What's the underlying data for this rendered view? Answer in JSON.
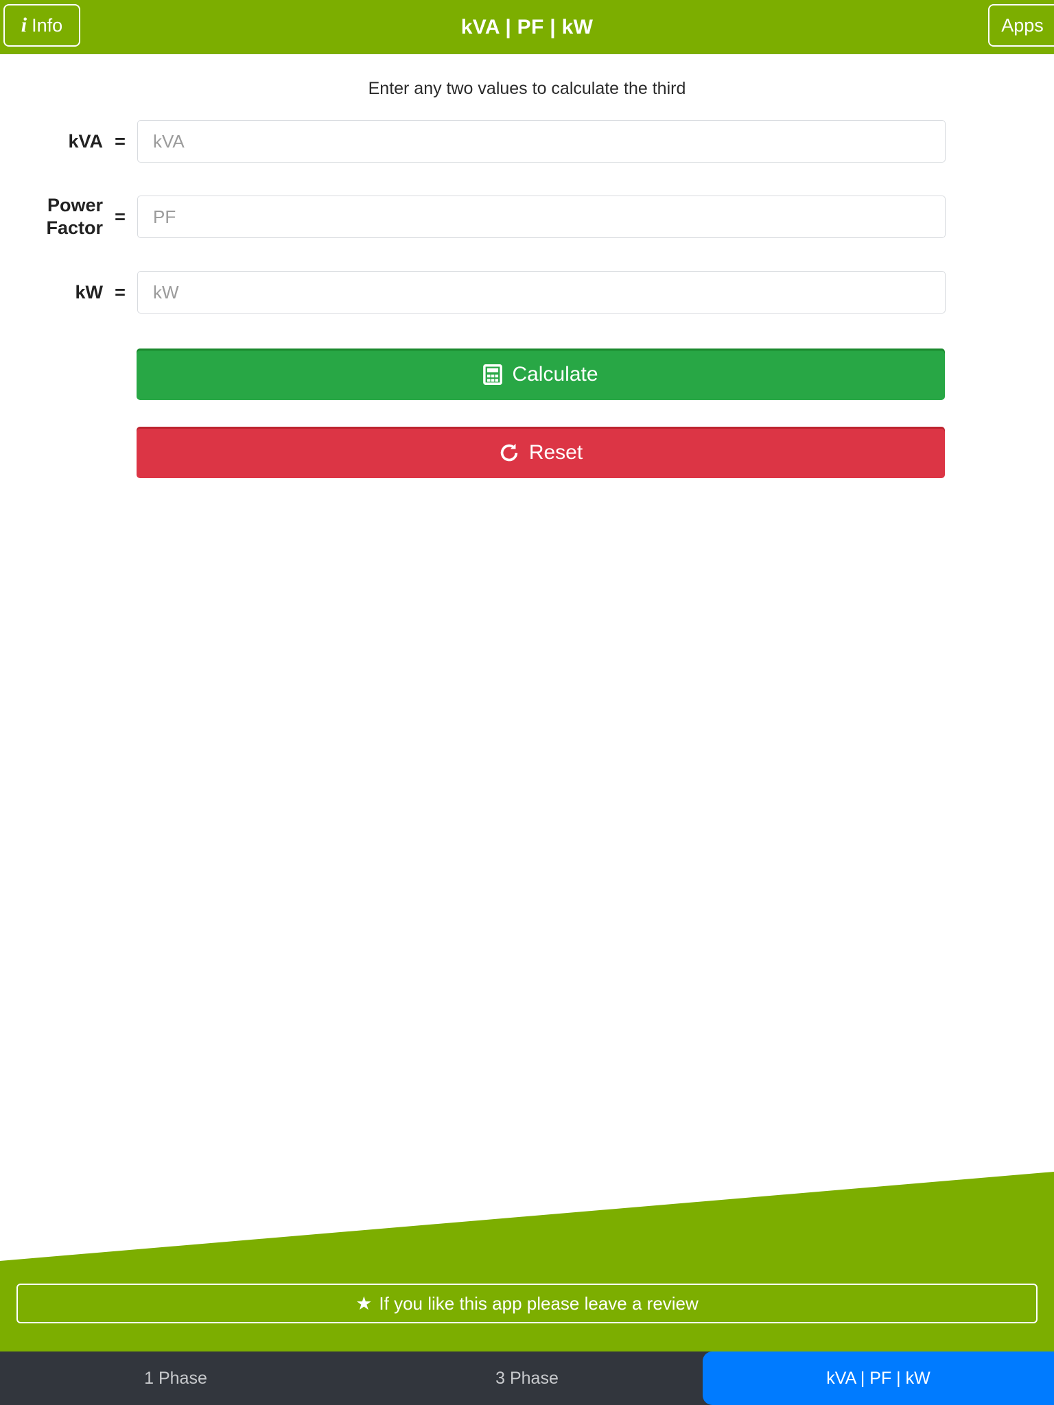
{
  "header": {
    "title": "kVA | PF | kW",
    "info_button": {
      "label": "Info",
      "icon": "info-italic-i"
    },
    "apps_button": {
      "label": "Apps"
    },
    "background_color": "#7CAE00"
  },
  "main": {
    "subtitle": "Enter any two values to calculate the third",
    "fields": [
      {
        "label": "kVA",
        "equals": "=",
        "value": "",
        "placeholder": "kVA"
      },
      {
        "label_line1": "Power",
        "label_line2": "Factor",
        "equals": "=",
        "value": "",
        "placeholder": "PF"
      },
      {
        "label": "kW",
        "equals": "=",
        "value": "",
        "placeholder": "kW"
      }
    ],
    "buttons": {
      "calculate": {
        "label": "Calculate",
        "icon": "calculator-icon",
        "color": "#28a745"
      },
      "reset": {
        "label": "Reset",
        "icon": "refresh-icon",
        "color": "#dc3545"
      }
    }
  },
  "footer": {
    "review_button": {
      "label": "If you like this app please leave a review",
      "icon": "star-icon"
    },
    "band_color": "#7CAE00"
  },
  "tabbar": {
    "background_color": "#32363d",
    "active_color": "#007bff",
    "tabs": [
      {
        "label": "1 Phase",
        "active": false
      },
      {
        "label": "3 Phase",
        "active": false
      },
      {
        "label": "kVA | PF | kW",
        "active": true
      }
    ]
  }
}
